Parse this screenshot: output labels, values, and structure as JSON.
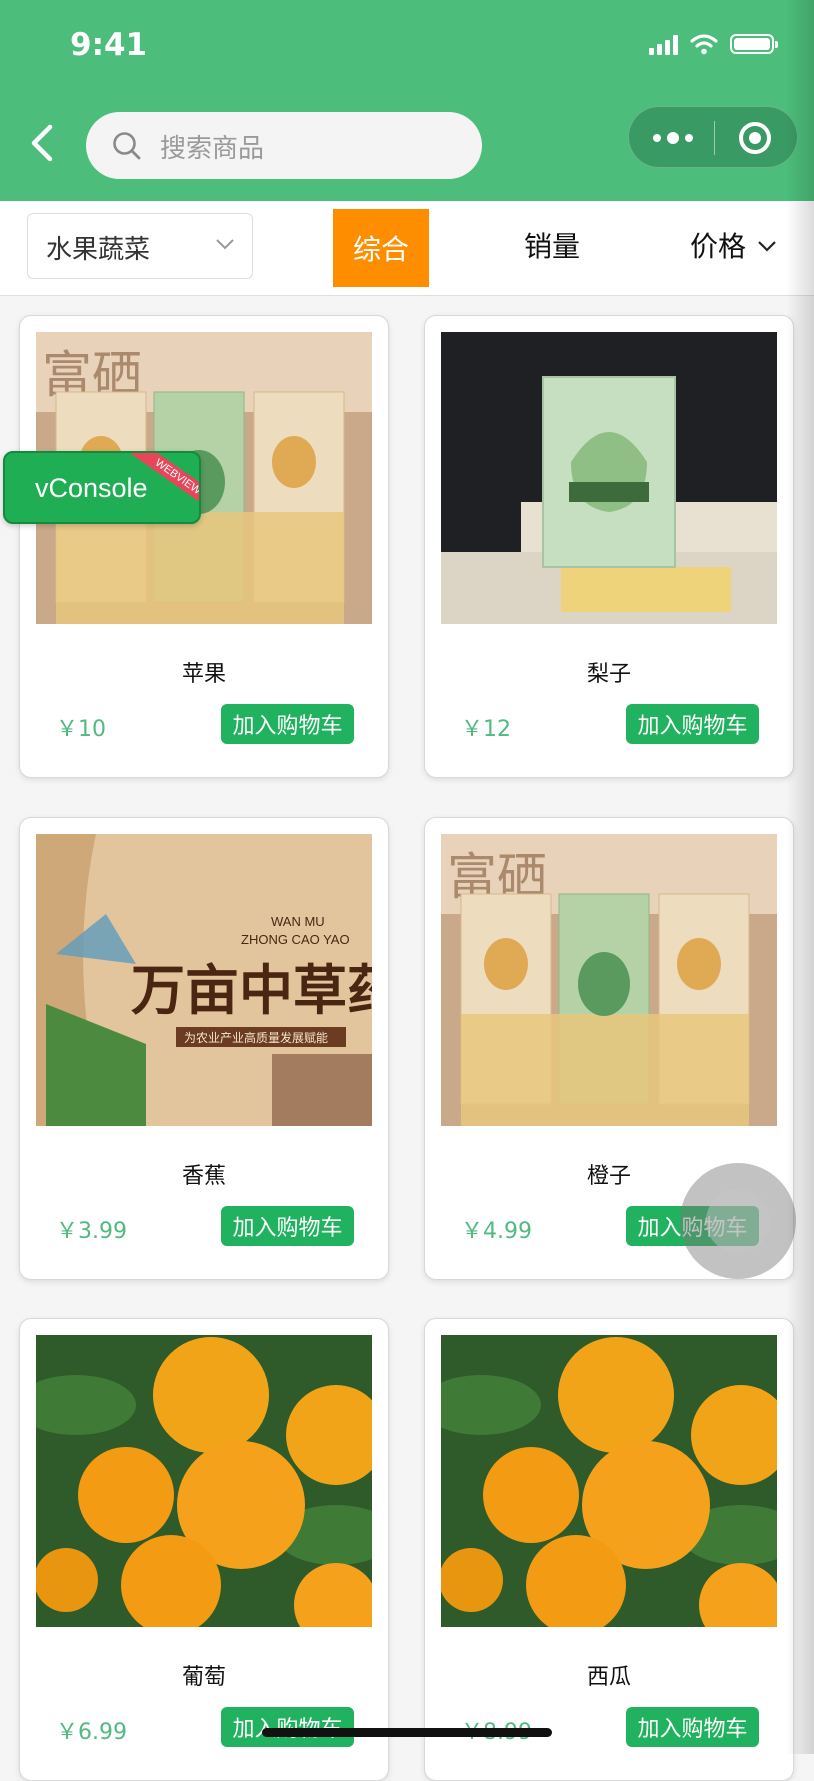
{
  "status_bar": {
    "time": "9:41"
  },
  "search": {
    "placeholder": "搜索商品"
  },
  "filter": {
    "category": "水果蔬菜",
    "sort_options": [
      "综合",
      "销量",
      "价格"
    ],
    "active_sort": "综合"
  },
  "products": [
    {
      "name": "苹果",
      "price": "￥10",
      "cart_label": "加入购物车",
      "image": "rice-packages"
    },
    {
      "name": "梨子",
      "price": "￥12",
      "cart_label": "加入购物车",
      "image": "rice-package-dark"
    },
    {
      "name": "香蕉",
      "price": "￥3.99",
      "cart_label": "加入购物车",
      "image": "herbal-poster"
    },
    {
      "name": "橙子",
      "price": "￥4.99",
      "cart_label": "加入购物车",
      "image": "rice-packages"
    },
    {
      "name": "葡萄",
      "price": "￥6.99",
      "cart_label": "加入购物车",
      "image": "oranges"
    },
    {
      "name": "西瓜",
      "price": "￥8.99",
      "cart_label": "加入购物车",
      "image": "oranges"
    }
  ],
  "poster": {
    "headline": "万亩中草药",
    "pinyin_line1": "WAN MU",
    "pinyin_line2": "ZHONG CAO YAO",
    "tagline": "为农业产业高质量发展赋能"
  },
  "vconsole": {
    "label": "vConsole",
    "ribbon": "WEBVIEW"
  },
  "colors": {
    "header": "#4cbd7a",
    "active_sort": "#fe8e00",
    "cart_button": "#21b25f",
    "price": "#52b983"
  }
}
